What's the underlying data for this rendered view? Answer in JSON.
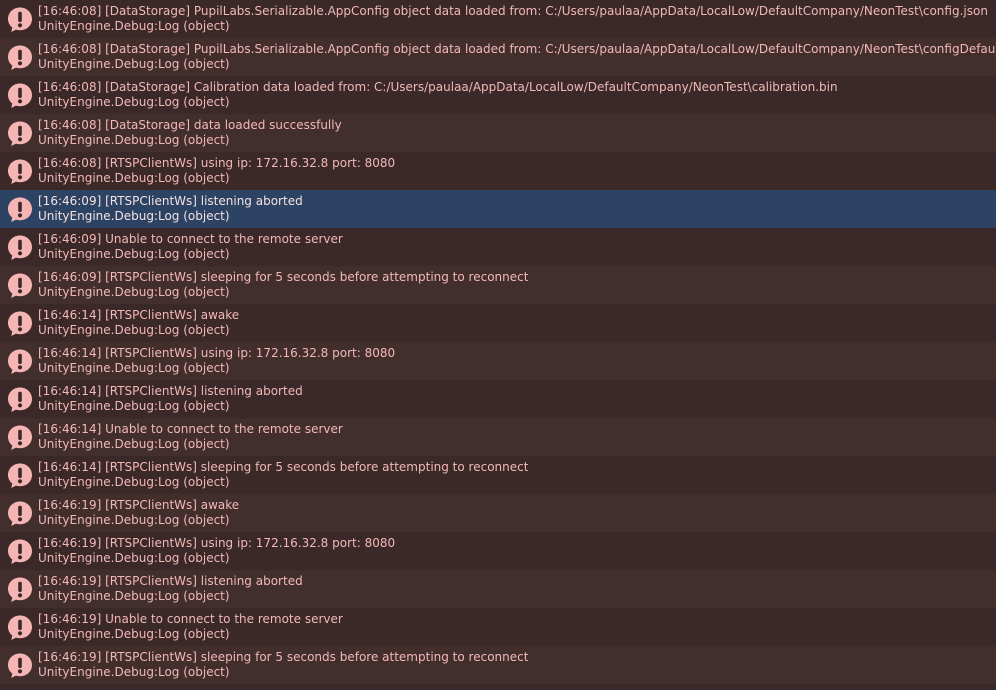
{
  "colors": {
    "row_odd": "#3b2828",
    "row_even": "#432e2e",
    "row_selected": "#2c4364",
    "text": "#f2b8b8",
    "icon": "#f5b5b5"
  },
  "icon_name": "exclamation-icon",
  "entries": [
    {
      "message": "[16:46:08] [DataStorage] PupilLabs.Serializable.AppConfig object data loaded from: C:/Users/paulaa/AppData/LocalLow/DefaultCompany/NeonTest\\config.json",
      "source": "UnityEngine.Debug:Log (object)",
      "selected": false
    },
    {
      "message": "[16:46:08] [DataStorage] PupilLabs.Serializable.AppConfig object data loaded from: C:/Users/paulaa/AppData/LocalLow/DefaultCompany/NeonTest\\configDefaults.json",
      "source": "UnityEngine.Debug:Log (object)",
      "selected": false
    },
    {
      "message": "[16:46:08] [DataStorage] Calibration data loaded from: C:/Users/paulaa/AppData/LocalLow/DefaultCompany/NeonTest\\calibration.bin",
      "source": "UnityEngine.Debug:Log (object)",
      "selected": false
    },
    {
      "message": "[16:46:08] [DataStorage] data loaded successfully",
      "source": "UnityEngine.Debug:Log (object)",
      "selected": false
    },
    {
      "message": "[16:46:08] [RTSPClientWs] using ip: 172.16.32.8 port: 8080",
      "source": "UnityEngine.Debug:Log (object)",
      "selected": false
    },
    {
      "message": "[16:46:09] [RTSPClientWs] listening aborted",
      "source": "UnityEngine.Debug:Log (object)",
      "selected": true
    },
    {
      "message": "[16:46:09] Unable to connect to the remote server",
      "source": "UnityEngine.Debug:Log (object)",
      "selected": false
    },
    {
      "message": "[16:46:09] [RTSPClientWs] sleeping for 5 seconds before attempting to reconnect",
      "source": "UnityEngine.Debug:Log (object)",
      "selected": false
    },
    {
      "message": "[16:46:14] [RTSPClientWs] awake",
      "source": "UnityEngine.Debug:Log (object)",
      "selected": false
    },
    {
      "message": "[16:46:14] [RTSPClientWs] using ip: 172.16.32.8 port: 8080",
      "source": "UnityEngine.Debug:Log (object)",
      "selected": false
    },
    {
      "message": "[16:46:14] [RTSPClientWs] listening aborted",
      "source": "UnityEngine.Debug:Log (object)",
      "selected": false
    },
    {
      "message": "[16:46:14] Unable to connect to the remote server",
      "source": "UnityEngine.Debug:Log (object)",
      "selected": false
    },
    {
      "message": "[16:46:14] [RTSPClientWs] sleeping for 5 seconds before attempting to reconnect",
      "source": "UnityEngine.Debug:Log (object)",
      "selected": false
    },
    {
      "message": "[16:46:19] [RTSPClientWs] awake",
      "source": "UnityEngine.Debug:Log (object)",
      "selected": false
    },
    {
      "message": "[16:46:19] [RTSPClientWs] using ip: 172.16.32.8 port: 8080",
      "source": "UnityEngine.Debug:Log (object)",
      "selected": false
    },
    {
      "message": "[16:46:19] [RTSPClientWs] listening aborted",
      "source": "UnityEngine.Debug:Log (object)",
      "selected": false
    },
    {
      "message": "[16:46:19] Unable to connect to the remote server",
      "source": "UnityEngine.Debug:Log (object)",
      "selected": false
    },
    {
      "message": "[16:46:19] [RTSPClientWs] sleeping for 5 seconds before attempting to reconnect",
      "source": "UnityEngine.Debug:Log (object)",
      "selected": false
    }
  ]
}
